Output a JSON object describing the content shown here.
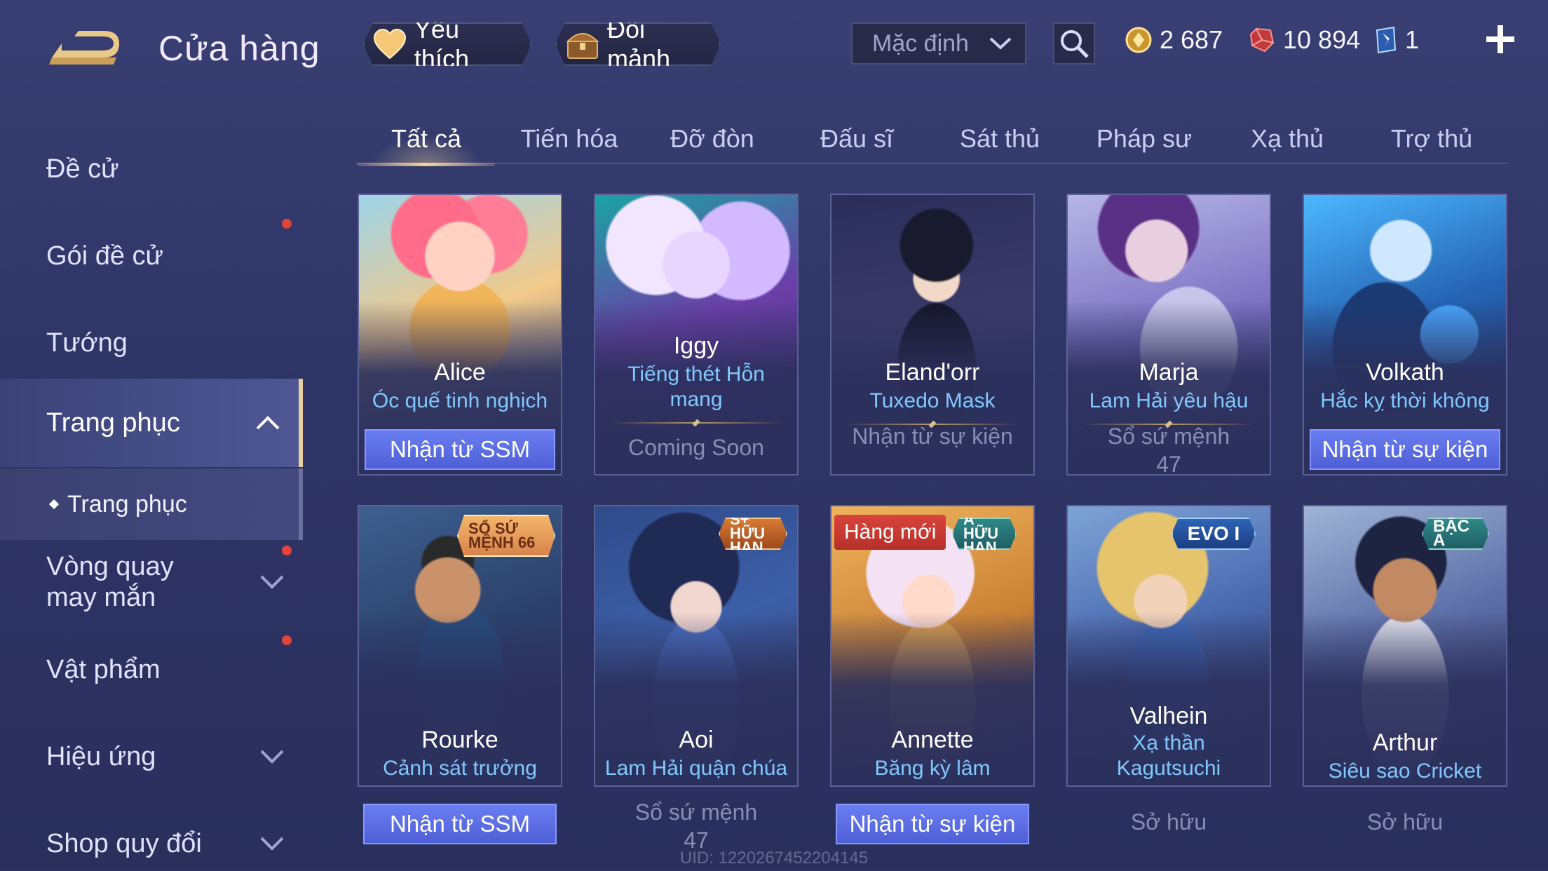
{
  "header": {
    "title": "Cửa hàng",
    "favorites_label": "Yêu thích",
    "shard_exchange_label": "Đổi mảnh",
    "sort_selected": "Mặc định"
  },
  "currencies": {
    "gold": "2 687",
    "voucher": "10 894",
    "shard": "1"
  },
  "sidebar": {
    "items": [
      {
        "label": "Đề cử"
      },
      {
        "label": "Gói đề cử"
      },
      {
        "label": "Tướng"
      },
      {
        "label": "Trang phục"
      },
      {
        "label": "Vòng quay may mắn"
      },
      {
        "label": "Vật phẩm"
      },
      {
        "label": "Hiệu ứng"
      },
      {
        "label": "Shop quy đổi"
      }
    ],
    "sub_item": "Trang phục"
  },
  "tabs": [
    "Tất cả",
    "Tiến hóa",
    "Đỡ đòn",
    "Đấu sĩ",
    "Sát thủ",
    "Pháp sư",
    "Xạ thủ",
    "Trợ thủ"
  ],
  "cards": [
    {
      "hero": "Alice",
      "skin": "Óc quế tinh nghịch",
      "action": "Nhận từ SSM"
    },
    {
      "hero": "Iggy",
      "skin": "Tiếng thét Hỗn mang",
      "status": "Coming Soon"
    },
    {
      "hero": "Eland'orr",
      "skin": "Tuxedo Mask",
      "status": "Nhận từ sự kiện"
    },
    {
      "hero": "Marja",
      "skin": "Lam Hải yêu hậu",
      "status": "Sổ sứ mệnh 47"
    },
    {
      "hero": "Volkath",
      "skin": "Hắc kỵ thời không",
      "action": "Nhận từ sự kiện"
    },
    {
      "hero": "Rourke",
      "skin": "Cảnh sát trưởng",
      "action": "Nhận từ SSM",
      "badge": "SỔ SỨ MỆNH 66"
    },
    {
      "hero": "Aoi",
      "skin": "Lam Hải quận chúa",
      "status": "Sổ sứ mệnh 47",
      "badge": "S+ HỮU HẠN"
    },
    {
      "hero": "Annette",
      "skin": "Băng kỳ lâm",
      "action": "Nhận từ sự kiện",
      "badge": "A HỮU HẠN",
      "new_label": "Hàng mới"
    },
    {
      "hero": "Valhein",
      "skin": "Xạ thần Kagutsuchi",
      "status": "Sở hữu",
      "badge": "EVO I"
    },
    {
      "hero": "Arthur",
      "skin": "Siêu sao Cricket",
      "status": "Sở hữu",
      "badge": "BẬC A"
    }
  ],
  "uid": "UID: 1220267452204145",
  "colors": {
    "accent_gold": "#f2d49a",
    "action_blue": "#5b6de0",
    "skin_text": "#7fc9ff",
    "notify_dot": "#e2433c"
  },
  "icons": {
    "back": "back-arrow-icon",
    "favorite": "heart-icon",
    "shard": "chest-icon",
    "search": "search-icon",
    "gold": "gold-coin-icon",
    "voucher": "voucher-gem-icon",
    "shard_currency": "shard-icon",
    "plus": "plus-icon"
  }
}
